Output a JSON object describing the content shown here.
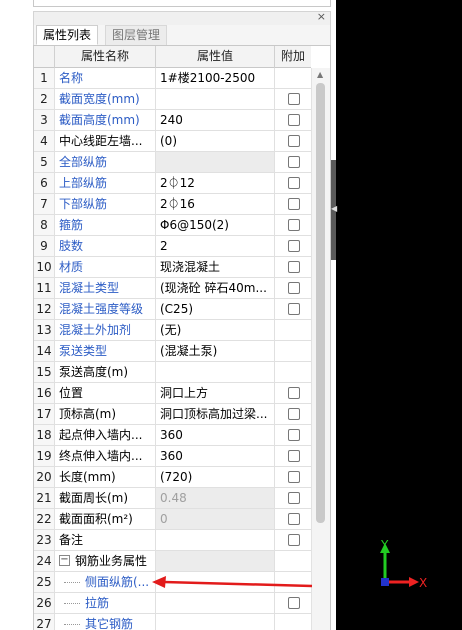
{
  "panel": {
    "close_glyph": "×",
    "tabs": [
      {
        "label": "属性列表",
        "active": true
      },
      {
        "label": "图层管理",
        "active": false
      }
    ],
    "headers": {
      "name": "属性名称",
      "value": "属性值",
      "add": "附加"
    }
  },
  "rows": [
    {
      "num": "1",
      "name": "名称",
      "value": "1#楼2100-2500",
      "blue": true,
      "checkbox": false,
      "grey": false
    },
    {
      "num": "2",
      "name": "截面宽度(mm)",
      "value": "",
      "blue": true,
      "checkbox": true,
      "grey": false
    },
    {
      "num": "3",
      "name": "截面高度(mm)",
      "value": "240",
      "blue": true,
      "checkbox": true,
      "grey": false
    },
    {
      "num": "4",
      "name": "中心线距左墙...",
      "value": "(0)",
      "blue": false,
      "checkbox": true,
      "grey": false
    },
    {
      "num": "5",
      "name": "全部纵筋",
      "value": "",
      "blue": true,
      "checkbox": true,
      "grey": true
    },
    {
      "num": "6",
      "name": "上部纵筋",
      "value": "2⏀12",
      "blue": true,
      "checkbox": true,
      "grey": false
    },
    {
      "num": "7",
      "name": "下部纵筋",
      "value": "2⏀16",
      "blue": true,
      "checkbox": true,
      "grey": false
    },
    {
      "num": "8",
      "name": "箍筋",
      "value": "Φ6@150(2)",
      "blue": true,
      "checkbox": true,
      "grey": false
    },
    {
      "num": "9",
      "name": "肢数",
      "value": "2",
      "blue": true,
      "checkbox": true,
      "grey": false
    },
    {
      "num": "10",
      "name": "材质",
      "value": "现浇混凝土",
      "blue": true,
      "checkbox": true,
      "grey": false
    },
    {
      "num": "11",
      "name": "混凝土类型",
      "value": "(现浇砼 碎石40m...",
      "blue": true,
      "checkbox": true,
      "grey": false
    },
    {
      "num": "12",
      "name": "混凝土强度等级",
      "value": "(C25)",
      "blue": true,
      "checkbox": true,
      "grey": false
    },
    {
      "num": "13",
      "name": "混凝土外加剂",
      "value": "(无)",
      "blue": true,
      "checkbox": false,
      "grey": false
    },
    {
      "num": "14",
      "name": "泵送类型",
      "value": "(混凝土泵)",
      "blue": true,
      "checkbox": false,
      "grey": false
    },
    {
      "num": "15",
      "name": "泵送高度(m)",
      "value": "",
      "blue": false,
      "checkbox": false,
      "grey": false
    },
    {
      "num": "16",
      "name": "位置",
      "value": "洞口上方",
      "blue": false,
      "checkbox": true,
      "grey": false
    },
    {
      "num": "17",
      "name": "顶标高(m)",
      "value": "洞口顶标高加过梁...",
      "blue": false,
      "checkbox": true,
      "grey": false
    },
    {
      "num": "18",
      "name": "起点伸入墙内...",
      "value": "360",
      "blue": false,
      "checkbox": true,
      "grey": false
    },
    {
      "num": "19",
      "name": "终点伸入墙内...",
      "value": "360",
      "blue": false,
      "checkbox": true,
      "grey": false
    },
    {
      "num": "20",
      "name": "长度(mm)",
      "value": "(720)",
      "blue": false,
      "checkbox": true,
      "grey": false
    },
    {
      "num": "21",
      "name": "截面周长(m)",
      "value": "0.48",
      "blue": false,
      "checkbox": true,
      "grey": true,
      "disabled": true
    },
    {
      "num": "22",
      "name": "截面面积(m²)",
      "value": "0",
      "blue": false,
      "checkbox": true,
      "grey": true,
      "disabled": true
    },
    {
      "num": "23",
      "name": "备注",
      "value": "",
      "blue": false,
      "checkbox": true,
      "grey": false
    },
    {
      "num": "24",
      "name": "钢筋业务属性",
      "value": "",
      "blue": false,
      "checkbox": false,
      "grey": true,
      "expander": "−"
    },
    {
      "num": "25",
      "name": "侧面纵筋(...",
      "value": "",
      "blue": true,
      "checkbox": false,
      "grey": false,
      "child": true
    },
    {
      "num": "26",
      "name": "拉筋",
      "value": "",
      "blue": true,
      "checkbox": true,
      "grey": false,
      "child": true
    },
    {
      "num": "27",
      "name": "其它钢筋",
      "value": "",
      "blue": true,
      "checkbox": false,
      "grey": false,
      "child": true
    }
  ],
  "axis": {
    "y_label": "Y",
    "x_label": "X",
    "y_color": "#22cc22",
    "x_color": "#ee2222",
    "origin_color": "#2233cc"
  },
  "colors": {
    "annotation_arrow": "#e21b1b",
    "link_blue": "#2c5cc5"
  }
}
